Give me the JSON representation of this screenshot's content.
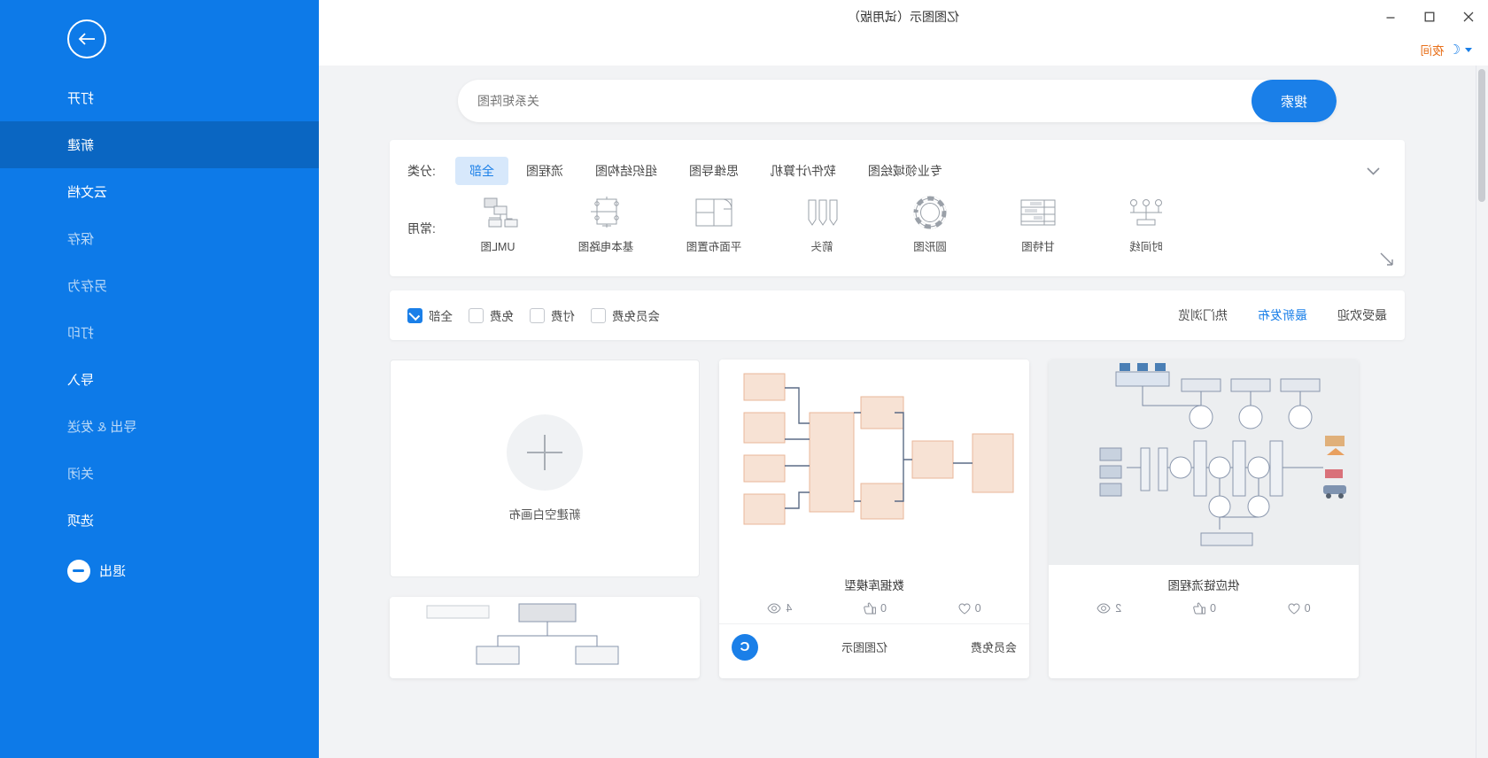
{
  "window": {
    "title": "亿图图示（试用版）",
    "controls": {
      "close": "✕",
      "maximize": "▢",
      "minimize": "﹘"
    }
  },
  "menubar": {
    "items": [
      {
        "label": "夜间",
        "icon": "moon-icon"
      }
    ]
  },
  "search": {
    "placeholder": "关系矩阵图",
    "button_label": "搜索"
  },
  "category": {
    "label": "分类:",
    "chips": [
      "全部",
      "流程图",
      "组织结构图",
      "思维导图",
      "软件/计算机",
      "专业领域绘图"
    ],
    "active": "全部",
    "expand_icon": "chevron-down-icon"
  },
  "common": {
    "label": "常用:",
    "expand_icon": "chevron-down-icon",
    "templates": [
      {
        "name": "UML图",
        "icon": "uml-diagram-icon"
      },
      {
        "name": "基本电路图",
        "icon": "circuit-diagram-icon"
      },
      {
        "name": "平面布置图",
        "icon": "floor-plan-icon"
      },
      {
        "name": "箭头",
        "icon": "arrows-icon"
      },
      {
        "name": "圆形图",
        "icon": "circular-diagram-icon"
      },
      {
        "name": "甘特图",
        "icon": "gantt-chart-icon"
      },
      {
        "name": "时间线",
        "icon": "timeline-icon"
      }
    ]
  },
  "filter": {
    "sorts": [
      {
        "label": "热门浏览",
        "active": false
      },
      {
        "label": "最新发布",
        "active": true
      },
      {
        "label": "最受欢迎",
        "active": false
      }
    ],
    "checkboxes": [
      {
        "label": "全部",
        "checked": true
      },
      {
        "label": "免费",
        "checked": false
      },
      {
        "label": "付费",
        "checked": false
      },
      {
        "label": "会员免费",
        "checked": false
      }
    ]
  },
  "cards": [
    {
      "title": "供应链流程图",
      "views": "2",
      "likes": "0",
      "favorites": "0",
      "thumb_style": "grey"
    },
    {
      "title": "数据库模型",
      "views": "4",
      "likes": "0",
      "favorites": "0",
      "thumb_style": "white",
      "footer": {
        "brand": "亿图图示",
        "price": "会员免费",
        "logo_glyph": "C"
      }
    }
  ],
  "blank_canvas": {
    "label": "新建空白画布",
    "icon": "plus-icon"
  },
  "rail": {
    "back_icon": "arrow-right-icon",
    "items": [
      {
        "label": "打开",
        "state": "normal"
      },
      {
        "label": "新建",
        "state": "active"
      },
      {
        "label": "云文档",
        "state": "normal"
      },
      {
        "label": "保存",
        "state": "dim"
      },
      {
        "label": "另存为",
        "state": "dim"
      },
      {
        "label": "打印",
        "state": "dim"
      },
      {
        "label": "导入",
        "state": "normal"
      },
      {
        "label": "导出 & 发送",
        "state": "dim"
      },
      {
        "label": "关闭",
        "state": "dim"
      },
      {
        "label": "选项",
        "state": "normal"
      },
      {
        "label": "退出",
        "state": "normal",
        "icon": "exit-icon"
      }
    ]
  },
  "colors": {
    "brand_blue": "#0d7ae8",
    "rail_active": "#0a66c2",
    "chip_active_bg": "#d7e8fb",
    "accent_orange": "#e8701a",
    "page_bg": "#f2f3f5"
  }
}
